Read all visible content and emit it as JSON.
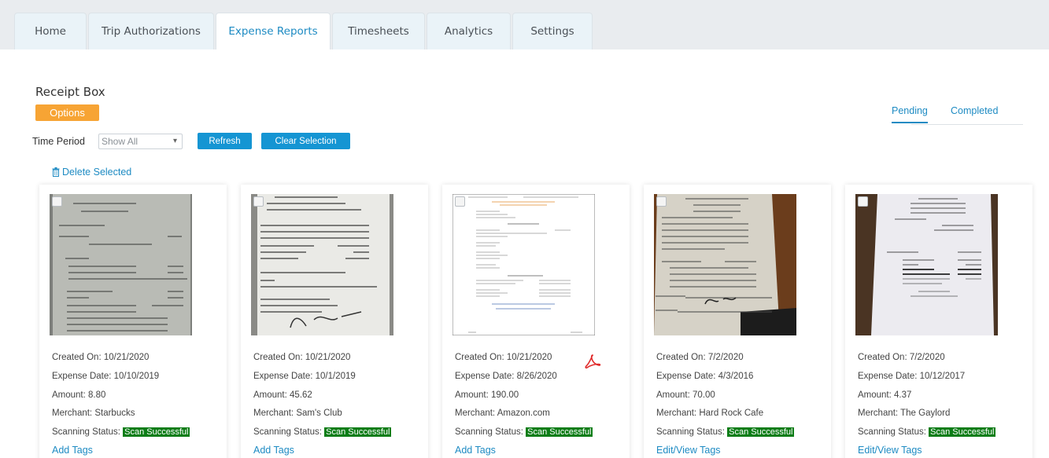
{
  "tabs": [
    {
      "label": "Home"
    },
    {
      "label": "Trip Authorizations"
    },
    {
      "label": "Expense Reports"
    },
    {
      "label": "Timesheets"
    },
    {
      "label": "Analytics"
    },
    {
      "label": "Settings"
    }
  ],
  "page": {
    "title": "Receipt Box",
    "options_label": "Options",
    "status_tabs": {
      "pending": "Pending",
      "completed": "Completed"
    },
    "time_period_label": "Time Period",
    "time_period_value": "Show All",
    "refresh_label": "Refresh",
    "clear_label": "Clear Selection",
    "delete_label": "Delete Selected"
  },
  "labels": {
    "created": "Created On: ",
    "expense_date": "Expense Date: ",
    "amount": "Amount: ",
    "merchant": "Merchant: ",
    "scanning": "Scanning Status: "
  },
  "cards": [
    {
      "created": "10/21/2020",
      "expense_date": "10/10/2019",
      "amount": "8.80",
      "merchant": "Starbucks",
      "status": "Scan Successful",
      "tags": "Add Tags"
    },
    {
      "created": "10/21/2020",
      "expense_date": "10/1/2019",
      "amount": "45.62",
      "merchant": "Sam's Club",
      "status": "Scan Successful",
      "tags": "Add Tags"
    },
    {
      "created": "10/21/2020",
      "expense_date": "8/26/2020",
      "amount": "190.00",
      "merchant": "Amazon.com",
      "status": "Scan Successful",
      "tags": "Add Tags"
    },
    {
      "created": "7/2/2020",
      "expense_date": "4/3/2016",
      "amount": "70.00",
      "merchant": "Hard Rock Cafe",
      "status": "Scan Successful",
      "tags": "Edit/View Tags"
    },
    {
      "created": "7/2/2020",
      "expense_date": "10/12/2017",
      "amount": "4.37",
      "merchant": "The Gaylord",
      "status": "Scan Successful",
      "tags": "Edit/View Tags"
    }
  ],
  "colors": {
    "accent": "#1e8bc3",
    "options": "#f7a434",
    "button": "#1595d3",
    "success": "#0d7d17"
  },
  "icons": {
    "delete": "trash-icon",
    "pdf": "pdf-icon",
    "select": "checkbox"
  }
}
